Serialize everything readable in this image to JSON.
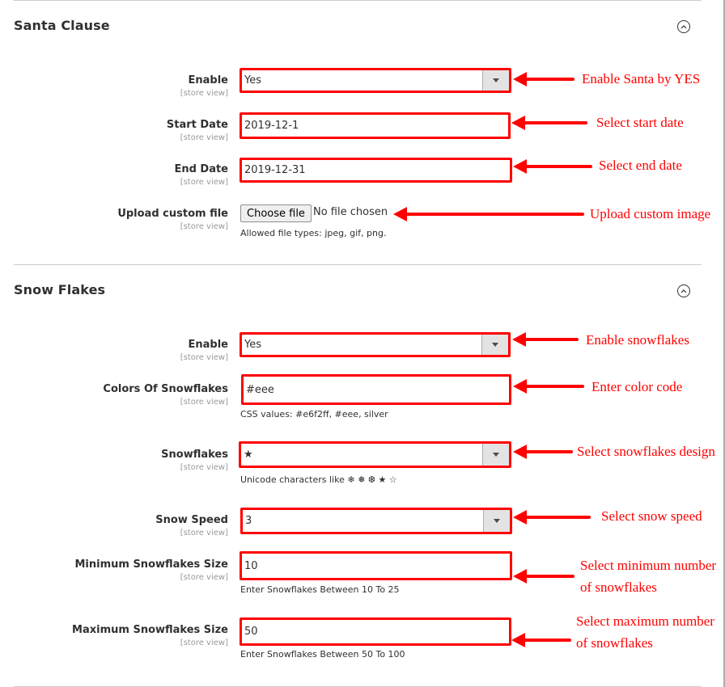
{
  "sections": [
    {
      "title": "Santa Clause",
      "collapse_icon": "chevron-up-circle-icon",
      "fields": [
        {
          "label": "Enable",
          "scope": "[store view]",
          "type": "select",
          "value": "Yes"
        },
        {
          "label": "Start Date",
          "scope": "[store view]",
          "type": "text",
          "value": "2019-12-1"
        },
        {
          "label": "End Date",
          "scope": "[store view]",
          "type": "text",
          "value": "2019-12-31"
        },
        {
          "label": "Upload custom file",
          "scope": "[store view]",
          "type": "file",
          "button_label": "Choose file",
          "status": "No file chosen",
          "note": "Allowed file types: jpeg, gif, png."
        }
      ]
    },
    {
      "title": "Snow Flakes",
      "collapse_icon": "chevron-up-circle-icon",
      "fields": [
        {
          "label": "Enable",
          "scope": "[store view]",
          "type": "select",
          "value": "Yes"
        },
        {
          "label": "Colors Of Snowflakes",
          "scope": "[store view]",
          "type": "text",
          "value": "#eee",
          "note": "CSS values: #e6f2ff, #eee, silver"
        },
        {
          "label": "Snowflakes",
          "scope": "[store view]",
          "type": "select",
          "value": "★",
          "note": "Unicode characters like ❄ ❅ ❆ ★ ☆"
        },
        {
          "label": "Snow Speed",
          "scope": "[store view]",
          "type": "select",
          "value": "3"
        },
        {
          "label": "Minimum Snowflakes Size",
          "scope": "[store view]",
          "type": "text",
          "value": "10",
          "note": "Enter Snowflakes Between 10 To 25"
        },
        {
          "label": "Maximum Snowflakes Size",
          "scope": "[store view]",
          "type": "text",
          "value": "50",
          "note": "Enter Snowflakes Between 50 To 100"
        }
      ]
    }
  ],
  "annotations": {
    "santa_enable": "Enable Santa by YES",
    "start_date": "Select start date",
    "end_date": "Select end date",
    "upload": "Upload custom image",
    "snow_enable": "Enable snowflakes",
    "color": "Enter color code",
    "design": "Select snowflakes design",
    "speed": "Select snow speed",
    "min_line1": "Select minimum number",
    "min_line2": "of snowflakes",
    "max_line1": "Select maximum number",
    "max_line2": "of snowflakes"
  },
  "colors": {
    "annotation": "#ff0000",
    "text": "#303030",
    "scope": "#999999"
  }
}
